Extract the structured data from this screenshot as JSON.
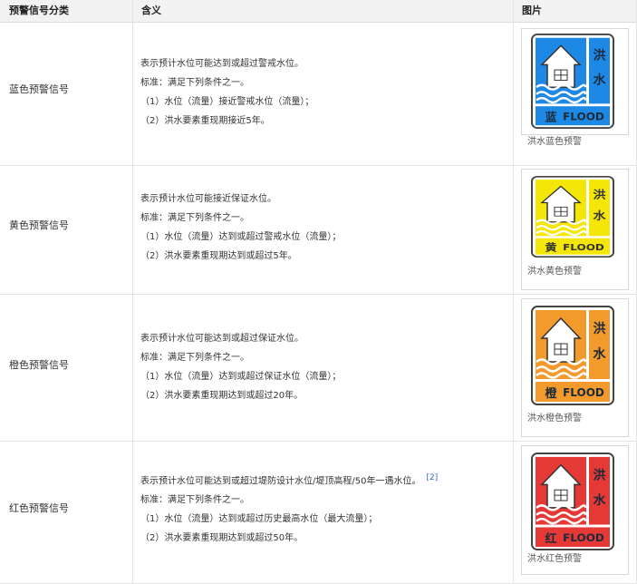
{
  "table": {
    "headers": [
      "预警信号分类",
      "含义",
      "图片"
    ],
    "rows": [
      {
        "category": "蓝色预警信号",
        "lines": [
          "表示预计水位可能达到或超过警戒水位。",
          "标准：满足下列条件之一。",
          "（1）水位（流量）接近警戒水位（流量）；",
          "（2）洪水要素重现期接近5年。"
        ],
        "ref": "",
        "sign_char": "蓝",
        "caption": "洪水蓝色预警",
        "color": "#1e88e5"
      },
      {
        "category": "黄色预警信号",
        "lines": [
          "表示预计水位可能接近保证水位。",
          "标准：满足下列条件之一。",
          "（1）水位（流量）达到或超过警戒水位（流量）；",
          "（2）洪水要素重现期达到或超过5年。"
        ],
        "ref": "",
        "sign_char": "黄",
        "caption": "洪水黄色预警",
        "color": "#f5e60a"
      },
      {
        "category": "橙色预警信号",
        "lines": [
          "表示预计水位可能达到或超过保证水位。",
          "标准：满足下列条件之一。",
          "（1）水位（流量）达到或超过保证水位（流量）；",
          "（2）洪水要素重现期达到或超过20年。"
        ],
        "ref": "",
        "sign_char": "橙",
        "caption": "洪水橙色预警",
        "color": "#f39a2c"
      },
      {
        "category": "红色预警信号",
        "lines": [
          "表示预计水位可能达到或超过堤防设计水位/堤顶高程/50年一遇水位。",
          "标准：满足下列条件之一。",
          "（1）水位（流量）达到或超过历史最高水位（最大流量）；",
          "（2）洪水要素重现期达到或超过50年。"
        ],
        "ref": "[2]",
        "sign_char": "红",
        "caption": "洪水红色预警",
        "color": "#e53935"
      }
    ]
  },
  "sign": {
    "flood_text": "FLOOD",
    "hong": "洪",
    "shui": "水",
    "house_char": "田"
  }
}
